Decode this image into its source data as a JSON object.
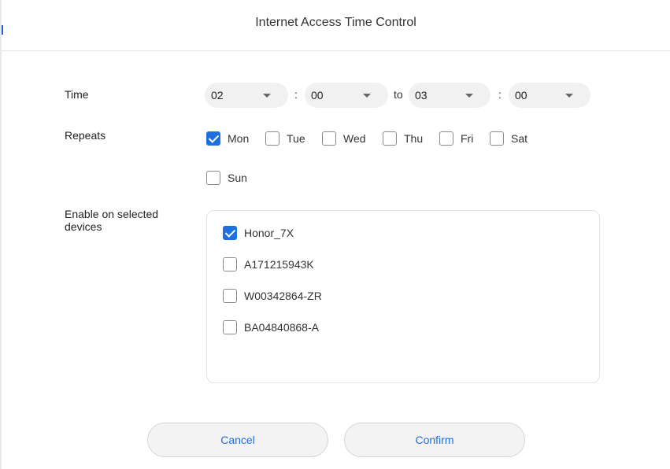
{
  "dialog": {
    "title": "Internet Access Time Control"
  },
  "time": {
    "label": "Time",
    "start_hour": "02",
    "start_minute": "00",
    "to_label": "to",
    "end_hour": "03",
    "end_minute": "00",
    "colon": ":"
  },
  "repeats": {
    "label": "Repeats",
    "days": [
      {
        "label": "Mon",
        "checked": true
      },
      {
        "label": "Tue",
        "checked": false
      },
      {
        "label": "Wed",
        "checked": false
      },
      {
        "label": "Thu",
        "checked": false
      },
      {
        "label": "Fri",
        "checked": false
      },
      {
        "label": "Sat",
        "checked": false
      },
      {
        "label": "Sun",
        "checked": false
      }
    ]
  },
  "devices": {
    "label": "Enable on selected devices",
    "items": [
      {
        "name": "Honor_7X",
        "checked": true
      },
      {
        "name": "A171215943K",
        "checked": false
      },
      {
        "name": "W00342864-ZR",
        "checked": false
      },
      {
        "name": "BA04840868-A",
        "checked": false
      }
    ]
  },
  "buttons": {
    "cancel": "Cancel",
    "confirm": "Confirm"
  },
  "colors": {
    "accent": "#1e6fe0",
    "select_bg": "#f1f1f1"
  }
}
